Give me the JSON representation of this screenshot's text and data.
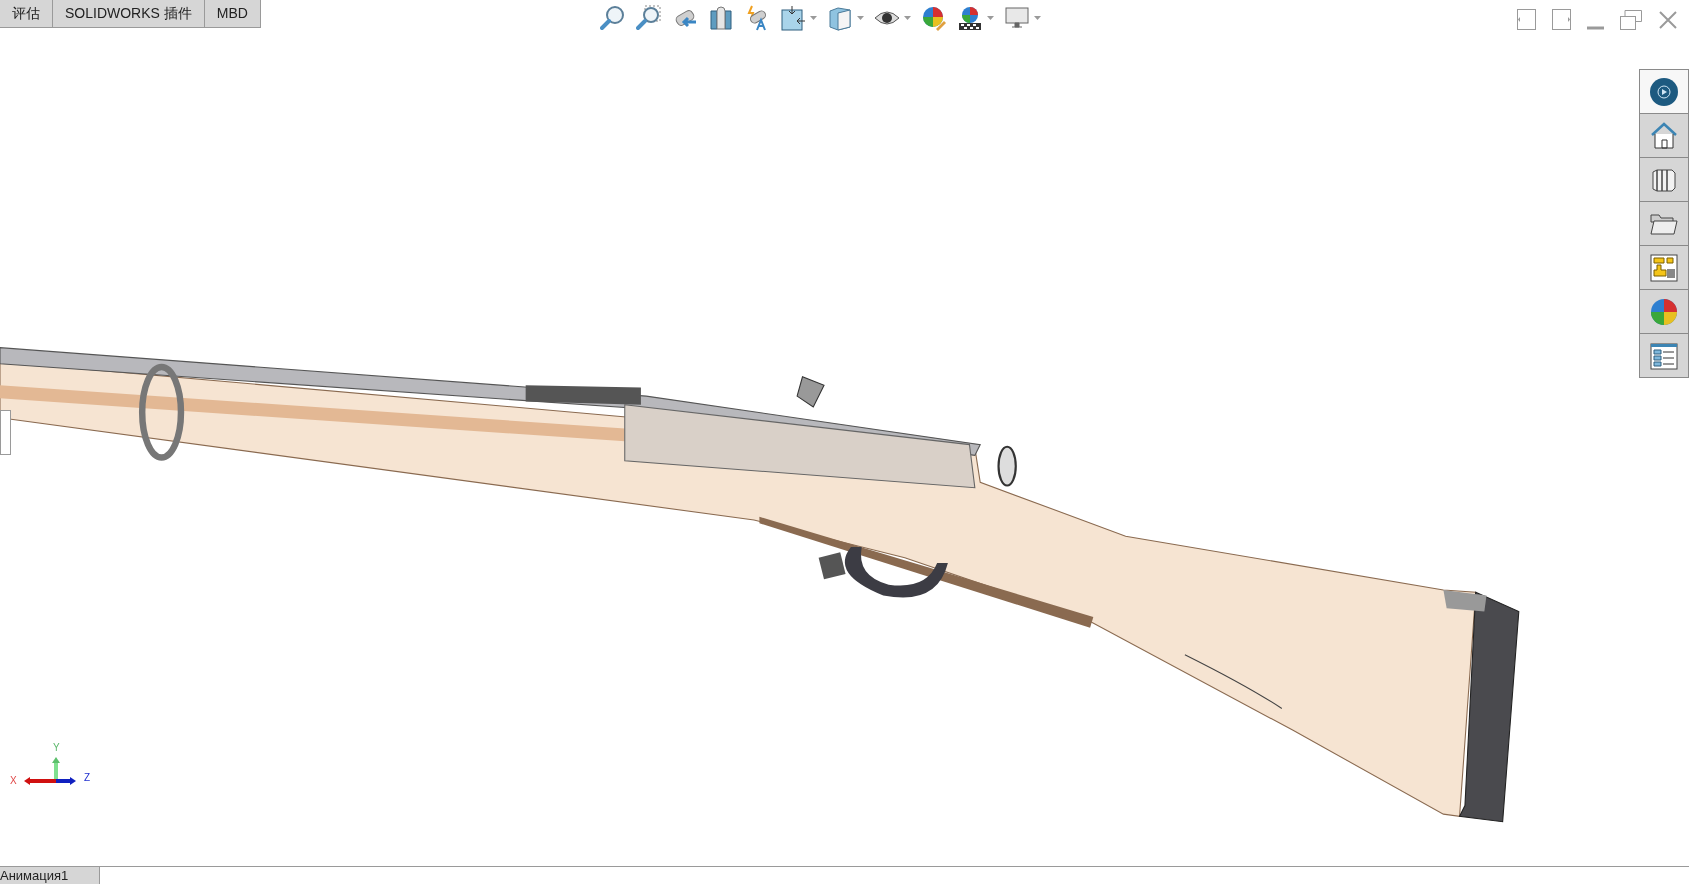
{
  "tabs": [
    {
      "label": "评估"
    },
    {
      "label": "SOLIDWORKS 插件"
    },
    {
      "label": "MBD"
    }
  ],
  "task_pane": [
    {
      "selected": true
    },
    {
      "selected": false
    },
    {
      "selected": false
    },
    {
      "selected": false
    },
    {
      "selected": false
    },
    {
      "selected": false
    },
    {
      "selected": false
    }
  ],
  "triad": {
    "x": "X",
    "y": "Y",
    "z": "Z"
  },
  "bottom_tabs": [
    {
      "label": "Анимация1"
    }
  ]
}
